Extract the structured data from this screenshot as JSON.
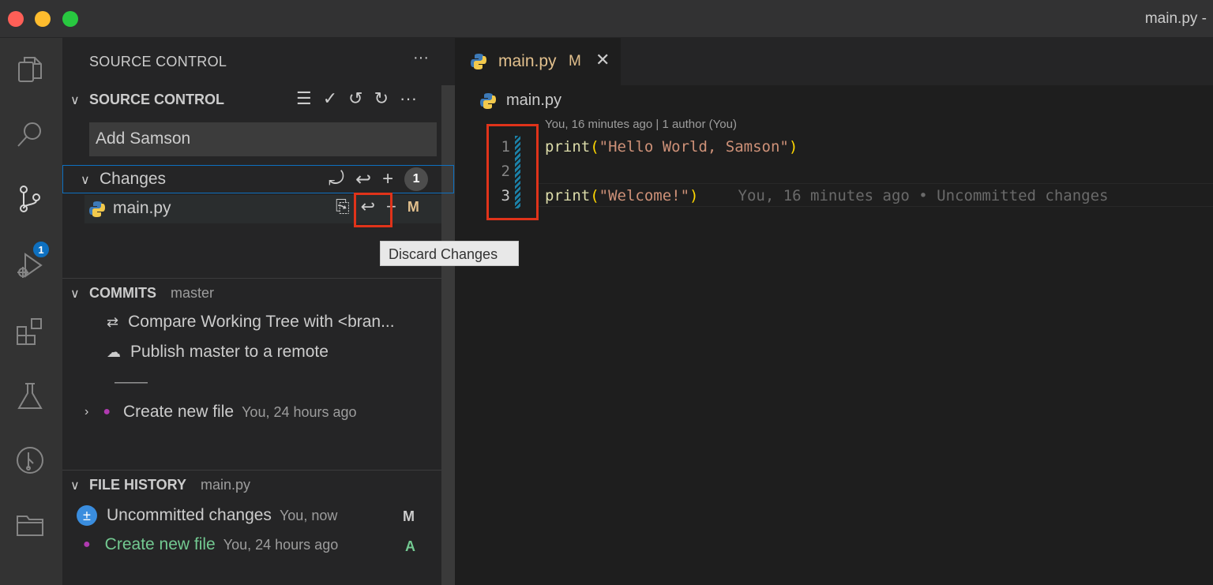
{
  "window": {
    "title": "main.py -"
  },
  "sidebar": {
    "header": "SOURCE CONTROL",
    "more": "···",
    "source_control": {
      "title": "SOURCE CONTROL",
      "commit_message": "Add Samson",
      "changes": {
        "label": "Changes",
        "count": "1",
        "files": [
          {
            "name": "main.py",
            "status": "M"
          }
        ]
      },
      "tooltip": "Discard Changes"
    },
    "commits": {
      "title": "COMMITS",
      "branch": "master",
      "items": [
        {
          "label": "Compare Working Tree with <bran..."
        },
        {
          "label": "Publish master to a remote"
        },
        {
          "label": "Create new file",
          "meta": "You, 24 hours ago"
        }
      ],
      "separator": "——"
    },
    "file_history": {
      "title": "FILE HISTORY",
      "file": "main.py",
      "items": [
        {
          "label": "Uncommitted changes",
          "meta": "You, now",
          "flag": "M"
        },
        {
          "label": "Create new file",
          "meta": "You, 24 hours ago",
          "flag": "A"
        }
      ]
    }
  },
  "activity_badge": "1",
  "editor": {
    "tab": {
      "label": "main.py",
      "flag": "M"
    },
    "breadcrumb": "main.py",
    "codelens": "You, 16 minutes ago | 1 author (You)",
    "lines": [
      {
        "num": "1",
        "fn": "print",
        "open": "(",
        "str": "\"Hello World, Samson\"",
        "close": ")"
      },
      {
        "num": "2"
      },
      {
        "num": "3",
        "fn": "print",
        "open": "(",
        "str": "\"Welcome!\"",
        "close": ")",
        "blame": "You, 16 minutes ago • Uncommitted changes"
      }
    ]
  },
  "colors": {
    "accent": "#0e70c0",
    "highlight": "#e0331a",
    "modified": "#e2c08d",
    "added": "#73c991"
  }
}
